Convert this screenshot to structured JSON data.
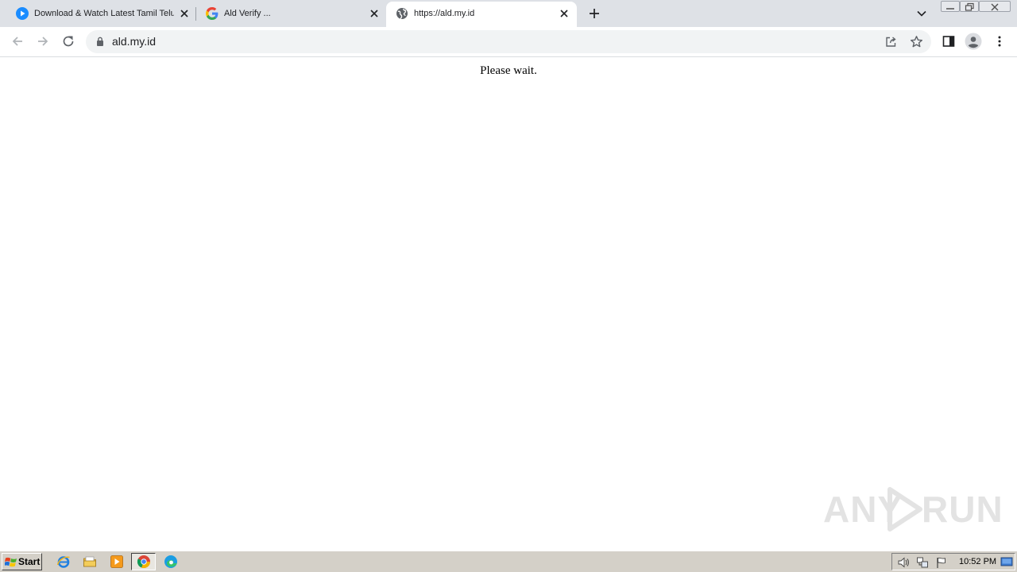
{
  "browser": {
    "tabs": [
      {
        "title": "Download & Watch Latest Tamil Telugu",
        "favicon": "play-circle-icon",
        "active": false
      },
      {
        "title": "Ald Verify ...",
        "favicon": "google-g-icon",
        "active": false
      },
      {
        "title": "https://ald.my.id",
        "favicon": "globe-icon",
        "active": true
      }
    ],
    "address": {
      "url": "ald.my.id"
    }
  },
  "page": {
    "message": "Please wait."
  },
  "watermark": {
    "left": "ANY",
    "right": "RUN"
  },
  "taskbar": {
    "start_label": "Start",
    "clock": "10:52 PM"
  },
  "colors": {
    "tabstrip_bg": "#dee1e6",
    "active_tab_bg": "#ffffff",
    "omnibox_bg": "#f1f3f4",
    "icon_gray": "#5f6368",
    "taskbar_bg": "#d4d0c8",
    "play_blue": "#1a8cff"
  }
}
